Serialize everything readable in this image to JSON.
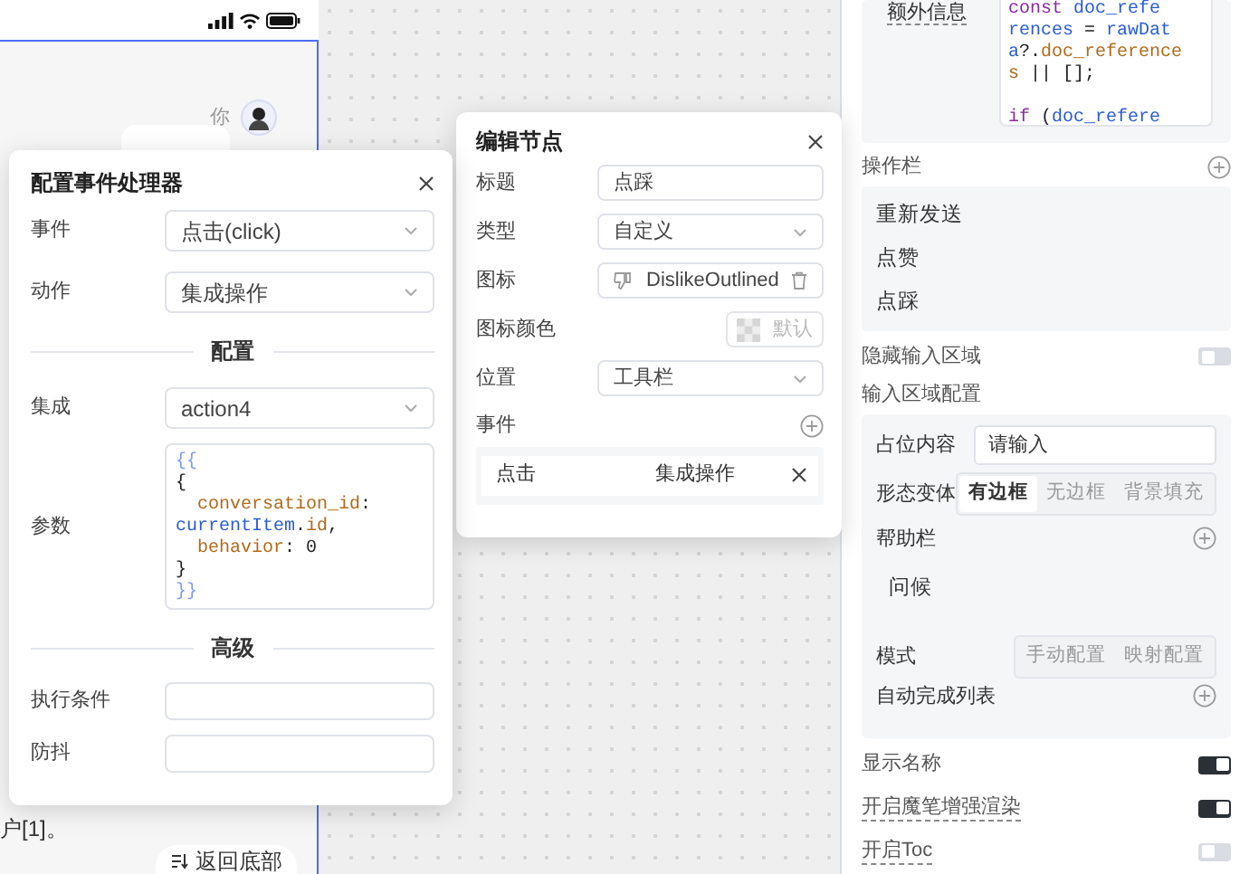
{
  "phone_preview": {
    "sender_label": "你",
    "answer_fragment": "户[1]。",
    "scroll_button": "返回底部"
  },
  "settings_panel": {
    "extra_info": {
      "label": "额外信息",
      "code_lines": [
        {
          "tokens": [
            {
              "text": "  const ",
              "kind": "keyword"
            },
            {
              "text": "doc_refe",
              "kind": "variable"
            }
          ]
        },
        {
          "tokens": [
            {
              "text": "rences",
              "kind": "variable"
            },
            {
              "text": " = ",
              "kind": "plain"
            },
            {
              "text": "rawDat",
              "kind": "variable"
            }
          ]
        },
        {
          "tokens": [
            {
              "text": "a",
              "kind": "variable"
            },
            {
              "text": "?.",
              "kind": "plain"
            },
            {
              "text": "doc_reference",
              "kind": "property"
            }
          ]
        },
        {
          "tokens": [
            {
              "text": "s",
              "kind": "property"
            },
            {
              "text": " || [];",
              "kind": "plain"
            }
          ]
        },
        {
          "kind": "blank"
        },
        {
          "tokens": [
            {
              "text": "  if",
              "kind": "keyword"
            },
            {
              "text": " (",
              "kind": "plain"
            },
            {
              "text": "doc_refere",
              "kind": "variable"
            }
          ]
        }
      ]
    },
    "action_bar": {
      "label": "操作栏",
      "items": [
        "重新发送",
        "点赞",
        "点踩"
      ]
    },
    "hide_input": {
      "label": "隐藏输入区域",
      "on": false,
      "hint": false
    },
    "input_area": {
      "title": "输入区域配置",
      "placeholder_setting": {
        "label": "占位内容",
        "value": "请输入"
      },
      "variant": {
        "label": "形态变体",
        "options": [
          {
            "label": "有边框",
            "selected": true
          },
          {
            "label": "无边框",
            "selected": false
          },
          {
            "label": "背景填充",
            "selected": false
          }
        ]
      },
      "help_bar": {
        "label": "帮助栏",
        "items": [
          "问候"
        ]
      },
      "mode": {
        "label": "模式",
        "options": [
          {
            "label": "手动配置",
            "selected": false
          },
          {
            "label": "映射配置",
            "selected": false
          }
        ]
      },
      "autocomplete": {
        "label": "自动完成列表"
      }
    },
    "toggles": [
      {
        "label": "显示名称",
        "on": true,
        "hint": false
      },
      {
        "label": "开启魔笔增强渲染",
        "on": true,
        "hint": true
      },
      {
        "label": "开启Toc",
        "on": false,
        "hint": true
      }
    ]
  },
  "node_editor": {
    "title": "编辑节点",
    "fields": [
      {
        "kind": "text",
        "label": "标题",
        "value": "点踩"
      },
      {
        "kind": "select",
        "label": "类型",
        "value": "自定义"
      },
      {
        "kind": "icon",
        "label": "图标",
        "value": "DislikeOutlined"
      },
      {
        "kind": "color",
        "label": "图标颜色",
        "value": "默认"
      },
      {
        "kind": "select",
        "label": "位置",
        "value": "工具栏"
      }
    ],
    "events_label": "事件",
    "events": [
      {
        "event": "点击",
        "action": "集成操作"
      }
    ]
  },
  "event_handler_dialog": {
    "title": "配置事件处理器",
    "fields": [
      {
        "kind": "select",
        "label": "事件",
        "value": "点击(click)"
      },
      {
        "kind": "select",
        "label": "动作",
        "value": "集成操作"
      },
      {
        "kind": "divider",
        "label": "配置"
      },
      {
        "kind": "select",
        "label": "集成",
        "value": "action4"
      },
      {
        "kind": "code",
        "label": "参数",
        "lines": [
          {
            "tokens": [
              {
                "text": "{{",
                "kind": "template"
              }
            ]
          },
          {
            "tokens": [
              {
                "text": "{",
                "kind": "plain"
              }
            ]
          },
          {
            "tokens": [
              {
                "text": "  conversation_id",
                "kind": "property"
              },
              {
                "text": ":",
                "kind": "plain"
              }
            ]
          },
          {
            "tokens": [
              {
                "text": "currentItem",
                "kind": "variable"
              },
              {
                "text": ".",
                "kind": "plain"
              },
              {
                "text": "id",
                "kind": "property"
              },
              {
                "text": ",",
                "kind": "plain"
              }
            ]
          },
          {
            "tokens": [
              {
                "text": "  behavior",
                "kind": "property"
              },
              {
                "text": ": ",
                "kind": "plain"
              },
              {
                "text": "0",
                "kind": "plain"
              }
            ]
          },
          {
            "tokens": [
              {
                "text": "}",
                "kind": "plain"
              }
            ]
          },
          {
            "tokens": [
              {
                "text": "}}",
                "kind": "template"
              }
            ]
          }
        ]
      },
      {
        "kind": "divider",
        "label": "高级"
      },
      {
        "kind": "input",
        "label": "执行条件"
      },
      {
        "kind": "input",
        "label": "防抖"
      }
    ]
  }
}
